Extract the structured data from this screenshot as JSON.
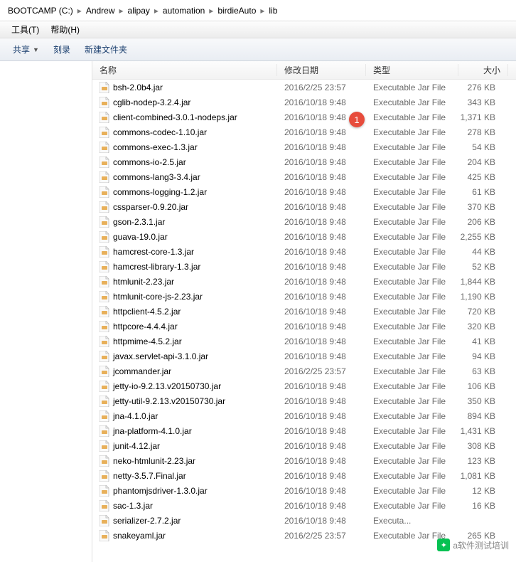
{
  "breadcrumb": [
    "BOOTCAMP (C:)",
    "Andrew",
    "alipay",
    "automation",
    "birdieAuto",
    "lib"
  ],
  "menubar": [
    "工具(T)",
    "帮助(H)"
  ],
  "toolbar": {
    "share": "共享",
    "burn": "刻录",
    "newfolder": "新建文件夹"
  },
  "columns": {
    "name": "名称",
    "date": "修改日期",
    "type": "类型",
    "size": "大小"
  },
  "annotation": {
    "label": "1",
    "targetIndex": 2
  },
  "watermark": {
    "text": "a软件测试培训"
  },
  "files": [
    {
      "name": "bsh-2.0b4.jar",
      "date": "2016/2/25 23:57",
      "type": "Executable Jar File",
      "size": "276 KB"
    },
    {
      "name": "cglib-nodep-3.2.4.jar",
      "date": "2016/10/18 9:48",
      "type": "Executable Jar File",
      "size": "343 KB"
    },
    {
      "name": "client-combined-3.0.1-nodeps.jar",
      "date": "2016/10/18 9:48",
      "type": "Executable Jar File",
      "size": "1,371 KB"
    },
    {
      "name": "commons-codec-1.10.jar",
      "date": "2016/10/18 9:48",
      "type": "Executable Jar File",
      "size": "278 KB"
    },
    {
      "name": "commons-exec-1.3.jar",
      "date": "2016/10/18 9:48",
      "type": "Executable Jar File",
      "size": "54 KB"
    },
    {
      "name": "commons-io-2.5.jar",
      "date": "2016/10/18 9:48",
      "type": "Executable Jar File",
      "size": "204 KB"
    },
    {
      "name": "commons-lang3-3.4.jar",
      "date": "2016/10/18 9:48",
      "type": "Executable Jar File",
      "size": "425 KB"
    },
    {
      "name": "commons-logging-1.2.jar",
      "date": "2016/10/18 9:48",
      "type": "Executable Jar File",
      "size": "61 KB"
    },
    {
      "name": "cssparser-0.9.20.jar",
      "date": "2016/10/18 9:48",
      "type": "Executable Jar File",
      "size": "370 KB"
    },
    {
      "name": "gson-2.3.1.jar",
      "date": "2016/10/18 9:48",
      "type": "Executable Jar File",
      "size": "206 KB"
    },
    {
      "name": "guava-19.0.jar",
      "date": "2016/10/18 9:48",
      "type": "Executable Jar File",
      "size": "2,255 KB"
    },
    {
      "name": "hamcrest-core-1.3.jar",
      "date": "2016/10/18 9:48",
      "type": "Executable Jar File",
      "size": "44 KB"
    },
    {
      "name": "hamcrest-library-1.3.jar",
      "date": "2016/10/18 9:48",
      "type": "Executable Jar File",
      "size": "52 KB"
    },
    {
      "name": "htmlunit-2.23.jar",
      "date": "2016/10/18 9:48",
      "type": "Executable Jar File",
      "size": "1,844 KB"
    },
    {
      "name": "htmlunit-core-js-2.23.jar",
      "date": "2016/10/18 9:48",
      "type": "Executable Jar File",
      "size": "1,190 KB"
    },
    {
      "name": "httpclient-4.5.2.jar",
      "date": "2016/10/18 9:48",
      "type": "Executable Jar File",
      "size": "720 KB"
    },
    {
      "name": "httpcore-4.4.4.jar",
      "date": "2016/10/18 9:48",
      "type": "Executable Jar File",
      "size": "320 KB"
    },
    {
      "name": "httpmime-4.5.2.jar",
      "date": "2016/10/18 9:48",
      "type": "Executable Jar File",
      "size": "41 KB"
    },
    {
      "name": "javax.servlet-api-3.1.0.jar",
      "date": "2016/10/18 9:48",
      "type": "Executable Jar File",
      "size": "94 KB"
    },
    {
      "name": "jcommander.jar",
      "date": "2016/2/25 23:57",
      "type": "Executable Jar File",
      "size": "63 KB"
    },
    {
      "name": "jetty-io-9.2.13.v20150730.jar",
      "date": "2016/10/18 9:48",
      "type": "Executable Jar File",
      "size": "106 KB"
    },
    {
      "name": "jetty-util-9.2.13.v20150730.jar",
      "date": "2016/10/18 9:48",
      "type": "Executable Jar File",
      "size": "350 KB"
    },
    {
      "name": "jna-4.1.0.jar",
      "date": "2016/10/18 9:48",
      "type": "Executable Jar File",
      "size": "894 KB"
    },
    {
      "name": "jna-platform-4.1.0.jar",
      "date": "2016/10/18 9:48",
      "type": "Executable Jar File",
      "size": "1,431 KB"
    },
    {
      "name": "junit-4.12.jar",
      "date": "2016/10/18 9:48",
      "type": "Executable Jar File",
      "size": "308 KB"
    },
    {
      "name": "neko-htmlunit-2.23.jar",
      "date": "2016/10/18 9:48",
      "type": "Executable Jar File",
      "size": "123 KB"
    },
    {
      "name": "netty-3.5.7.Final.jar",
      "date": "2016/10/18 9:48",
      "type": "Executable Jar File",
      "size": "1,081 KB"
    },
    {
      "name": "phantomjsdriver-1.3.0.jar",
      "date": "2016/10/18 9:48",
      "type": "Executable Jar File",
      "size": "12 KB"
    },
    {
      "name": "sac-1.3.jar",
      "date": "2016/10/18 9:48",
      "type": "Executable Jar File",
      "size": "16 KB"
    },
    {
      "name": "serializer-2.7.2.jar",
      "date": "2016/10/18 9:48",
      "type": "Executa...",
      "size": ""
    },
    {
      "name": "snakeyaml.jar",
      "date": "2016/2/25 23:57",
      "type": "Executable Jar File",
      "size": "265 KB"
    }
  ]
}
